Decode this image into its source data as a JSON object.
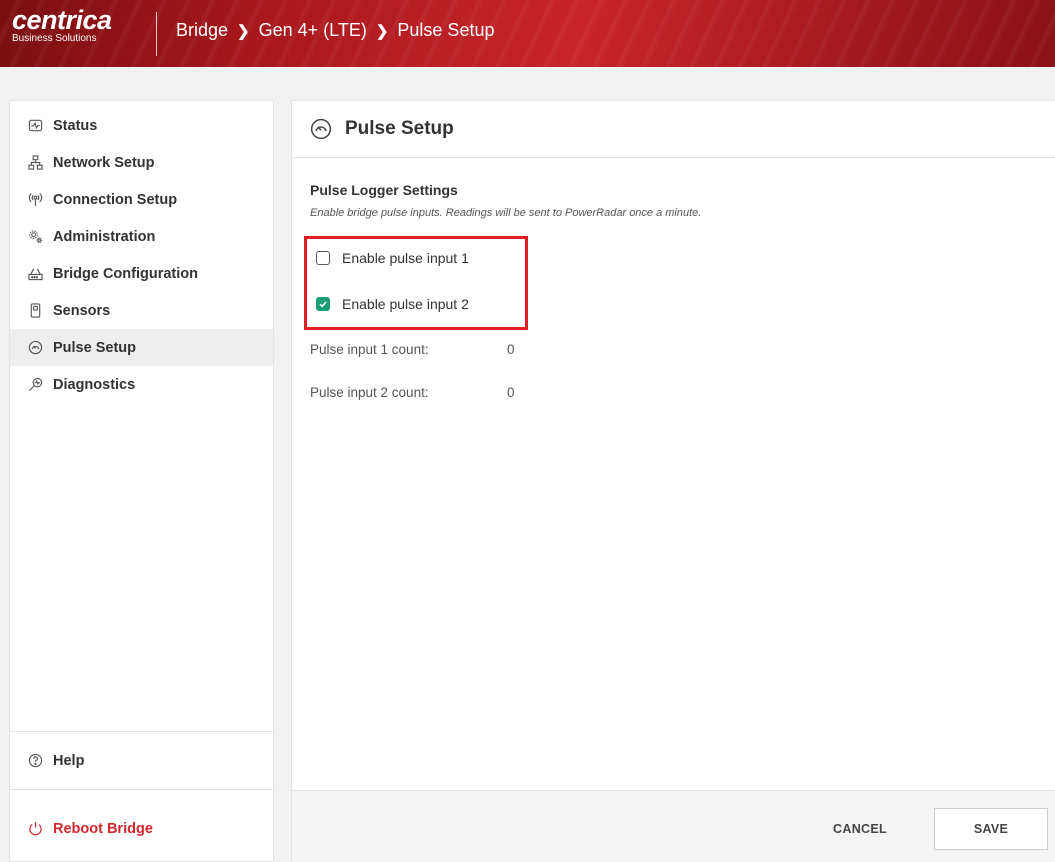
{
  "header": {
    "brand": "centrica",
    "brand_sub": "Business Solutions",
    "breadcrumb": [
      "Bridge",
      "Gen 4+ (LTE)",
      "Pulse Setup"
    ],
    "separator": "❯",
    "colors": {
      "header_red": "#b51e22",
      "accent_green": "#1a9e75",
      "highlight_red": "#e01e25"
    }
  },
  "sidebar": {
    "items": [
      {
        "label": "Status",
        "icon": "status-icon",
        "active": false
      },
      {
        "label": "Network Setup",
        "icon": "network-icon",
        "active": false
      },
      {
        "label": "Connection Setup",
        "icon": "antenna-icon",
        "active": false
      },
      {
        "label": "Administration",
        "icon": "gears-icon",
        "active": false
      },
      {
        "label": "Bridge Configuration",
        "icon": "router-icon",
        "active": false
      },
      {
        "label": "Sensors",
        "icon": "sensor-icon",
        "active": false
      },
      {
        "label": "Pulse Setup",
        "icon": "gauge-icon",
        "active": true
      },
      {
        "label": "Diagnostics",
        "icon": "stethoscope-icon",
        "active": false
      }
    ],
    "help_label": "Help",
    "reboot_label": "Reboot Bridge"
  },
  "main": {
    "title": "Pulse Setup",
    "section_title": "Pulse Logger Settings",
    "section_desc": "Enable bridge pulse inputs. Readings will be sent to PowerRadar once a minute.",
    "checkboxes": [
      {
        "label": "Enable pulse input 1",
        "checked": false
      },
      {
        "label": "Enable pulse input 2",
        "checked": true
      }
    ],
    "counts": [
      {
        "label": "Pulse input 1 count:",
        "value": "0"
      },
      {
        "label": "Pulse input 2 count:",
        "value": "0"
      }
    ],
    "cancel_label": "CANCEL",
    "save_label": "SAVE"
  }
}
